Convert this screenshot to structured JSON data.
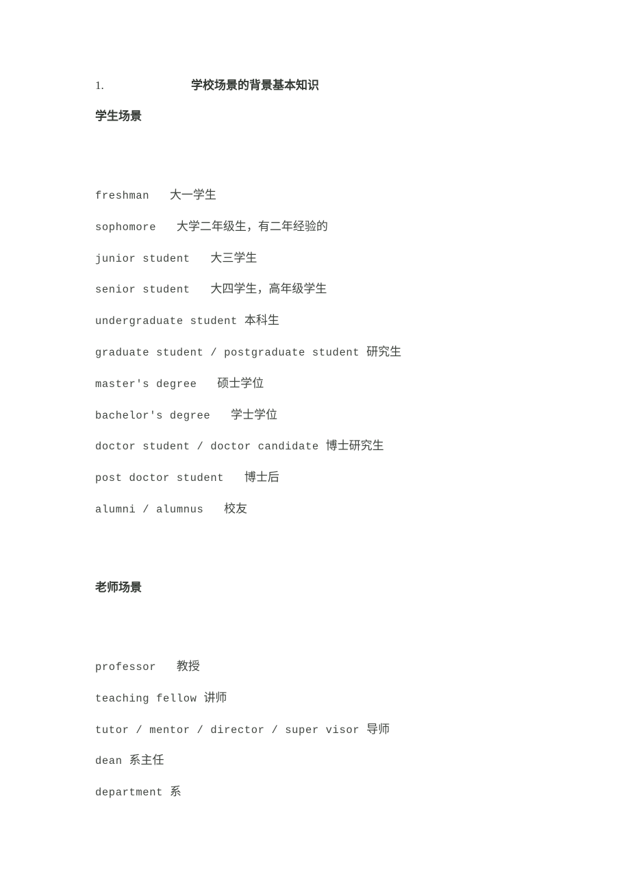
{
  "document": {
    "title": {
      "number": "1.",
      "text": "学校场景的背景基本知识"
    },
    "sections": [
      {
        "heading": "学生场景",
        "entries": [
          {
            "en": "freshman",
            "sep": "   ",
            "zh": "大一学生"
          },
          {
            "en": "sophomore",
            "sep": "   ",
            "zh": "大学二年级生，有二年经验的"
          },
          {
            "en": "junior student",
            "sep": "   ",
            "zh": "大三学生"
          },
          {
            "en": "senior student",
            "sep": "   ",
            "zh": "大四学生，高年级学生"
          },
          {
            "en": "undergraduate student",
            "sep": " ",
            "zh": "本科生"
          },
          {
            "en": "graduate student / postgraduate student",
            "sep": " ",
            "zh": "研究生"
          },
          {
            "en": "master's degree",
            "sep": "   ",
            "zh": "硕士学位"
          },
          {
            "en": "bachelor's degree",
            "sep": "   ",
            "zh": "学士学位"
          },
          {
            "en": "doctor student / doctor candidate",
            "sep": " ",
            "zh": "博士研究生"
          },
          {
            "en": "post doctor student",
            "sep": "   ",
            "zh": "博士后"
          },
          {
            "en": "alumni / alumnus",
            "sep": "   ",
            "zh": "校友"
          }
        ]
      },
      {
        "heading": "老师场景",
        "entries": [
          {
            "en": "professor",
            "sep": "   ",
            "zh": "教授"
          },
          {
            "en": "teaching fellow",
            "sep": " ",
            "zh": "讲师"
          },
          {
            "en": "tutor / mentor / director / super visor",
            "sep": " ",
            "zh": "导师"
          },
          {
            "en": "dean",
            "sep": " ",
            "zh": "系主任"
          },
          {
            "en": "department",
            "sep": " ",
            "zh": "系"
          }
        ]
      }
    ]
  }
}
